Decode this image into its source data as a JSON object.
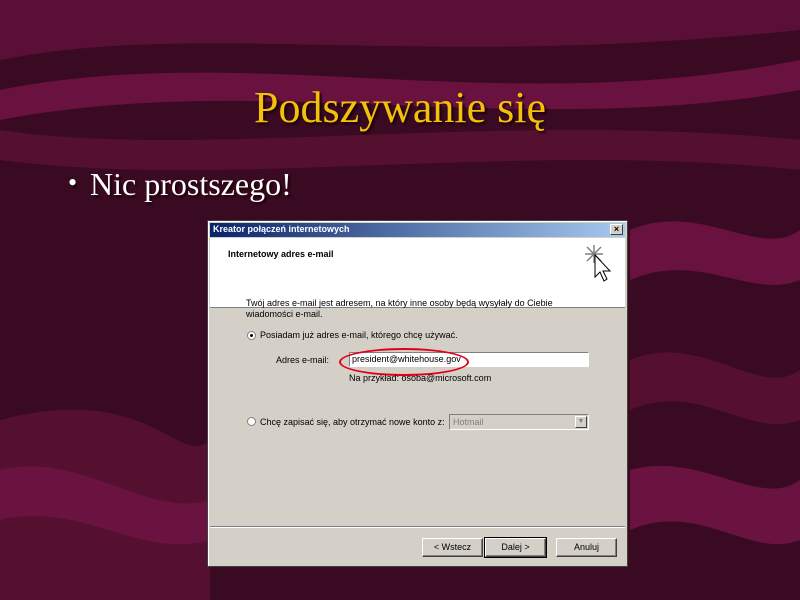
{
  "slide": {
    "title": "Podszywanie się",
    "bullet": "Nic prostszego!"
  },
  "dialog": {
    "window_title": "Kreator połączeń internetowych",
    "close_glyph": "×",
    "header_title": "Internetowy adres e-mail",
    "description": "Twój adres e-mail jest adresem, na który inne osoby będą wysyłały do Ciebie wiadomości e-mail.",
    "option_existing": "Posiadam już adres e-mail, którego chcę używać.",
    "email_label": "Adres e-mail:",
    "email_value": "president@whitehouse.gov",
    "example": "Na przykład: osoba@microsoft.com",
    "option_new": "Chcę zapisać się, aby otrzymać nowe konto z:",
    "provider": "Hotmail",
    "buttons": {
      "back": "< Wstecz",
      "next": "Dalej >",
      "cancel": "Anuluj"
    }
  },
  "colors": {
    "title": "#f2c10a",
    "background": "#3a0a22",
    "annotation": "#e0001a",
    "titlebar_start": "#0a246a"
  },
  "icons": {
    "wizard": "wizard-cursor-icon",
    "close": "close-icon",
    "dropdown": "chevron-down-icon"
  }
}
